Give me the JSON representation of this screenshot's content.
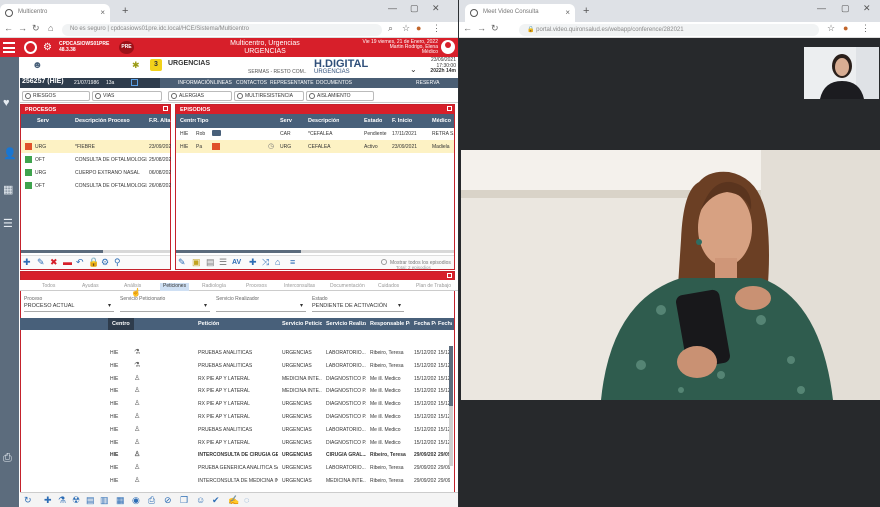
{
  "left_browser": {
    "tab_title": "Multicentro",
    "url": "No es seguro | cpdcasiows01pre.idc.local/HCE/Sistema/Multicentro"
  },
  "right_browser": {
    "tab_title": "Meet Video Consulta",
    "url": "portal.video.quironsalud.es/webapp/conference/282021"
  },
  "app_header": {
    "server": "CPDCASIOWS01PRE",
    "version": "48.3.38",
    "env_badge": "PRE",
    "center_line1": "Multicentro, Urgencias",
    "center_line2": "URGENCIAS",
    "datetime": "Vie 19 viernes, 21 de Enero, 2022",
    "user_name": "Martin Rodrigo, Elena",
    "user_role": "Médico"
  },
  "patient": {
    "id": "256257 (HIE)",
    "dob": "21/07/1986",
    "age": "13a",
    "badge_count": "3",
    "area": "URGENCIAS",
    "sub_area": "SERMAS - RESTO COM..",
    "brand": "H.DIGITAL",
    "brand_sub": "URGENCIAS",
    "episode_date": "23/09/2021",
    "episode_time": "17:30:00",
    "episode_duration": "2022h 14m",
    "dark_tabs": [
      "INFORMACIÓN",
      "LINEAS",
      "CONTACTOS",
      "REPRESENTANTE",
      "DOCUMENTOS",
      "RESERVA"
    ]
  },
  "filters": [
    "RIESGOS",
    "VIAS",
    "ALERGIAS",
    "MULTIRESISTENCIA",
    "AISLAMIENTO"
  ],
  "procesos": {
    "title": "PROCESOS",
    "columns": [
      "Serv",
      "Descripción Proceso",
      "F.R. Alta"
    ],
    "rows": [
      {
        "serv": "URG",
        "desc": "*FIEBRE",
        "date": "23/09/2021",
        "selected": true
      },
      {
        "serv": "OFT",
        "desc": "CONSULTA DE OFTALMOLOGÍA",
        "date": "25/08/2021",
        "selected": false
      },
      {
        "serv": "URG",
        "desc": "CUERPO EXTRAÑO NASAL",
        "date": "06/08/2021",
        "selected": false
      },
      {
        "serv": "OFT",
        "desc": "CONSULTA DE OFTALMOLOGÍA",
        "date": "26/08/2021",
        "selected": false
      }
    ]
  },
  "episodios": {
    "title": "EPISODIOS",
    "columns": [
      "Centro",
      "Tipo",
      "Serv",
      "Descripción",
      "Estado",
      "F. Inicio",
      "Médico"
    ],
    "rows": [
      {
        "centro": "HIE",
        "tipo": "Rob",
        "serv": "CAR",
        "desc": "*CEFALEA",
        "estado": "Pendiente",
        "inicio": "17/11/2021",
        "medico": "RETRA S.",
        "selected": false
      },
      {
        "centro": "HIE",
        "tipo": "Pa",
        "serv": "URG",
        "desc": "CEFALEA",
        "estado": "Activo",
        "inicio": "23/09/2021",
        "medico": "Madiela",
        "selected": true
      }
    ],
    "show_closed_label": "Mostrar todos los episodios",
    "show_closed_total": "Total: 2 episodios"
  },
  "orders": {
    "tabs": [
      "Todos",
      "Ayudas",
      "Análisis",
      "Peticiones",
      "Radiología",
      "Procesos",
      "Interconsultas",
      "Documentación",
      "Cuidados",
      "Plan de Trabajo"
    ],
    "active_tab": 3,
    "filter_labels": {
      "proceso": "Proceso",
      "servicio_peticionario": "Servicio Peticionario",
      "servicio_realizador": "Servicio Realizador",
      "estado": "Estado"
    },
    "filter_values": {
      "proceso": "PROCESO ACTUAL",
      "estado": "PENDIENTE DE ACTIVACIÓN"
    },
    "columns": [
      "Centro",
      "Petición",
      "Servicio Peticionario",
      "Servicio Realizador",
      "Responsable Petición",
      "Fecha Petición",
      "Fecha"
    ],
    "rows": [
      {
        "centro": "HIE",
        "peticion": "PRUEBAS ANALITICAS",
        "serv_pet": "URGENCIAS",
        "serv_real": "LABORATORIO...",
        "resp": "Ribeiro, Teresa",
        "fecha": "15/12/2021",
        "fecha2": "15/12",
        "bold": false
      },
      {
        "centro": "HIE",
        "peticion": "PRUEBAS ANALITICAS",
        "serv_pet": "URGENCIAS",
        "serv_real": "LABORATORIO...",
        "resp": "Ribeiro, Teresa",
        "fecha": "15/12/2021",
        "fecha2": "15/12",
        "bold": false
      },
      {
        "centro": "HIE",
        "peticion": "RX PIE AP Y LATERAL",
        "serv_pet": "MEDICINA INTE...",
        "serv_real": "DIAGNÓSTICO P...",
        "resp": "Me ill. Medico",
        "fecha": "15/12/2021",
        "fecha2": "15/12",
        "bold": false
      },
      {
        "centro": "HIE",
        "peticion": "RX PIE AP Y LATERAL",
        "serv_pet": "MEDICINA INTE...",
        "serv_real": "DIAGNÓSTICO P...",
        "resp": "Me ill. Medico",
        "fecha": "15/12/2021",
        "fecha2": "15/12",
        "bold": false
      },
      {
        "centro": "HIE",
        "peticion": "RX PIE AP Y LATERAL",
        "serv_pet": "URGENCIAS",
        "serv_real": "DIAGNÓSTICO P...",
        "resp": "Me ill. Medico",
        "fecha": "15/12/2021",
        "fecha2": "15/12",
        "bold": false
      },
      {
        "centro": "HIE",
        "peticion": "RX PIE AP Y LATERAL",
        "serv_pet": "URGENCIAS",
        "serv_real": "DIAGNÓSTICO P...",
        "resp": "Me ill. Medico",
        "fecha": "15/12/2021",
        "fecha2": "15/12",
        "bold": false
      },
      {
        "centro": "HIE",
        "peticion": "PRUEBAS ANALITICAS",
        "serv_pet": "URGENCIAS",
        "serv_real": "LABORATORIO...",
        "resp": "Me ill. Medico",
        "fecha": "15/12/2021",
        "fecha2": "15/12",
        "bold": false
      },
      {
        "centro": "HIE",
        "peticion": "RX PIE AP Y LATERAL",
        "serv_pet": "URGENCIAS",
        "serv_real": "DIAGNÓSTICO P...",
        "resp": "Me ill. Medico",
        "fecha": "15/12/2021",
        "fecha2": "15/12",
        "bold": false
      },
      {
        "centro": "HIE",
        "peticion": "INTERCONSULTA DE CIRUGÍA GEN...",
        "serv_pet": "URGENCIAS",
        "serv_real": "CIRUGÍA GRAL...",
        "resp": "Ribeiro, Teresa",
        "fecha": "29/09/2021",
        "fecha2": "29/09",
        "bold": true
      },
      {
        "centro": "HIE",
        "peticion": "PRUEBA GENERICA ANALITICA SA...",
        "serv_pet": "URGENCIAS",
        "serv_real": "LABORATORIO...",
        "resp": "Ribeiro, Teresa",
        "fecha": "29/09/2021",
        "fecha2": "29/09",
        "bold": false
      },
      {
        "centro": "HIE",
        "peticion": "INTERCONSULTA DE MEDICINA INT...",
        "serv_pet": "URGENCIAS",
        "serv_real": "MEDICINA INTE...",
        "resp": "Ribeiro, Teresa",
        "fecha": "29/09/2021",
        "fecha2": "29/09",
        "bold": false
      }
    ]
  },
  "colors": {
    "brand_red": "#d71f2a",
    "header_blue": "#48607a",
    "sidebar": "#5c6c7d",
    "selected_row": "#fdf2c4",
    "icon_blue": "#2d6db5"
  }
}
